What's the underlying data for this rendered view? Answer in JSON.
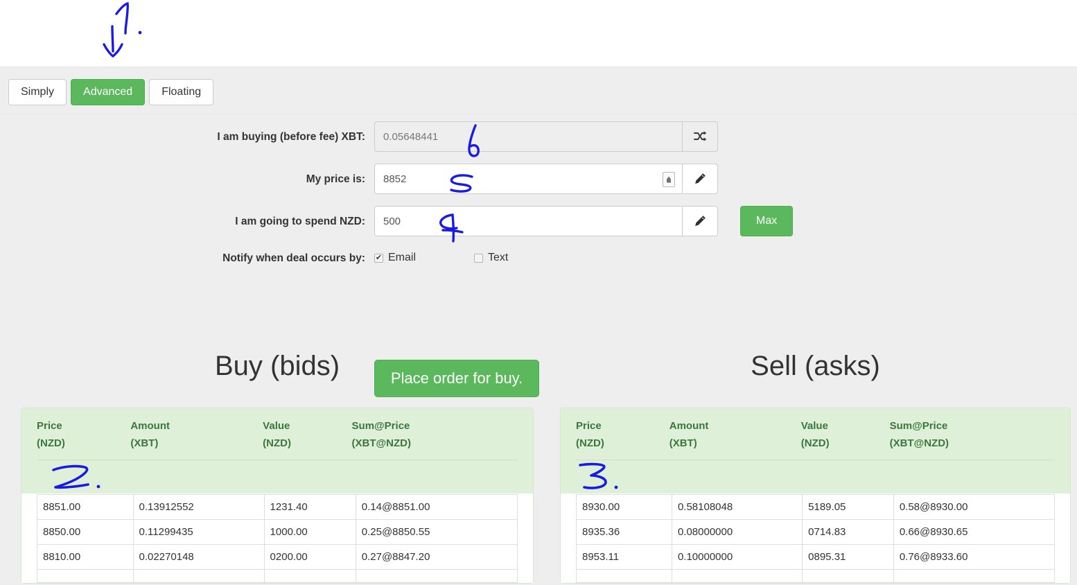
{
  "tabs": [
    {
      "label": "Simply",
      "active": false
    },
    {
      "label": "Advanced",
      "active": true
    },
    {
      "label": "Floating",
      "active": false
    }
  ],
  "form": {
    "rows": [
      {
        "label": "I am buying (before fee) XBT:",
        "value": "0.05648441",
        "placeholder": "",
        "disabled": true,
        "addon_icon": "shuffle-icon",
        "spinner": false
      },
      {
        "label": "My price is:",
        "value": "8852",
        "placeholder": "",
        "disabled": false,
        "addon_icon": "pencil-icon",
        "spinner": true
      },
      {
        "label": "I am going to spend NZD:",
        "value": "500",
        "placeholder": "",
        "disabled": false,
        "addon_icon": "pencil-icon",
        "spinner": false
      }
    ],
    "max_label": "Max",
    "notify_label": "Notify when deal occurs by:",
    "notify_options": [
      {
        "label": "Email",
        "checked": true,
        "mark": "✔"
      },
      {
        "label": "Text",
        "checked": false,
        "mark": ""
      }
    ],
    "place_order_label": "Place order for buy."
  },
  "book": {
    "columns": [
      {
        "line1": "Price",
        "line2": "(NZD)"
      },
      {
        "line1": "Amount",
        "line2": "(XBT)"
      },
      {
        "line1": "Value",
        "line2": "(NZD)"
      },
      {
        "line1": "Sum@Price",
        "line2": "(XBT@NZD)"
      }
    ],
    "buy": {
      "heading": "Buy (bids)",
      "rows": [
        [
          "8851.00",
          "0.13912552",
          "1231.40",
          "0.14@8851.00"
        ],
        [
          "8850.00",
          "0.11299435",
          "1000.00",
          "0.25@8850.55"
        ],
        [
          "8810.00",
          "0.02270148",
          "0200.00",
          "0.27@8847.20"
        ],
        [
          "",
          "",
          "",
          ""
        ]
      ]
    },
    "sell": {
      "heading": "Sell (asks)",
      "rows": [
        [
          "8930.00",
          "0.58108048",
          "5189.05",
          "0.58@8930.00"
        ],
        [
          "8935.36",
          "0.08000000",
          "0714.83",
          "0.66@8930.65"
        ],
        [
          "8953.11",
          "0.10000000",
          "0895.31",
          "0.76@8933.60"
        ],
        [
          "",
          "",
          "",
          ""
        ]
      ]
    }
  },
  "annotations": [
    {
      "id": "a1",
      "text": "1",
      "note": "arrow pointing down to tab bar"
    },
    {
      "id": "a2",
      "text": "2",
      "note": "marks buy bids table"
    },
    {
      "id": "a3",
      "text": "3",
      "note": "marks sell asks table"
    },
    {
      "id": "a4",
      "text": "4",
      "note": "marks spend NZD field"
    },
    {
      "id": "a5",
      "text": "5",
      "note": "marks my price field"
    },
    {
      "id": "a6",
      "text": "6",
      "note": "marks buying XBT field"
    }
  ],
  "colors": {
    "brand_green": "#5cb85c",
    "panel_green_bg": "#dff0d8",
    "panel_green_text": "#3c763d",
    "page_gray": "#eeeeee",
    "annotation_blue": "#1a1ae6"
  }
}
